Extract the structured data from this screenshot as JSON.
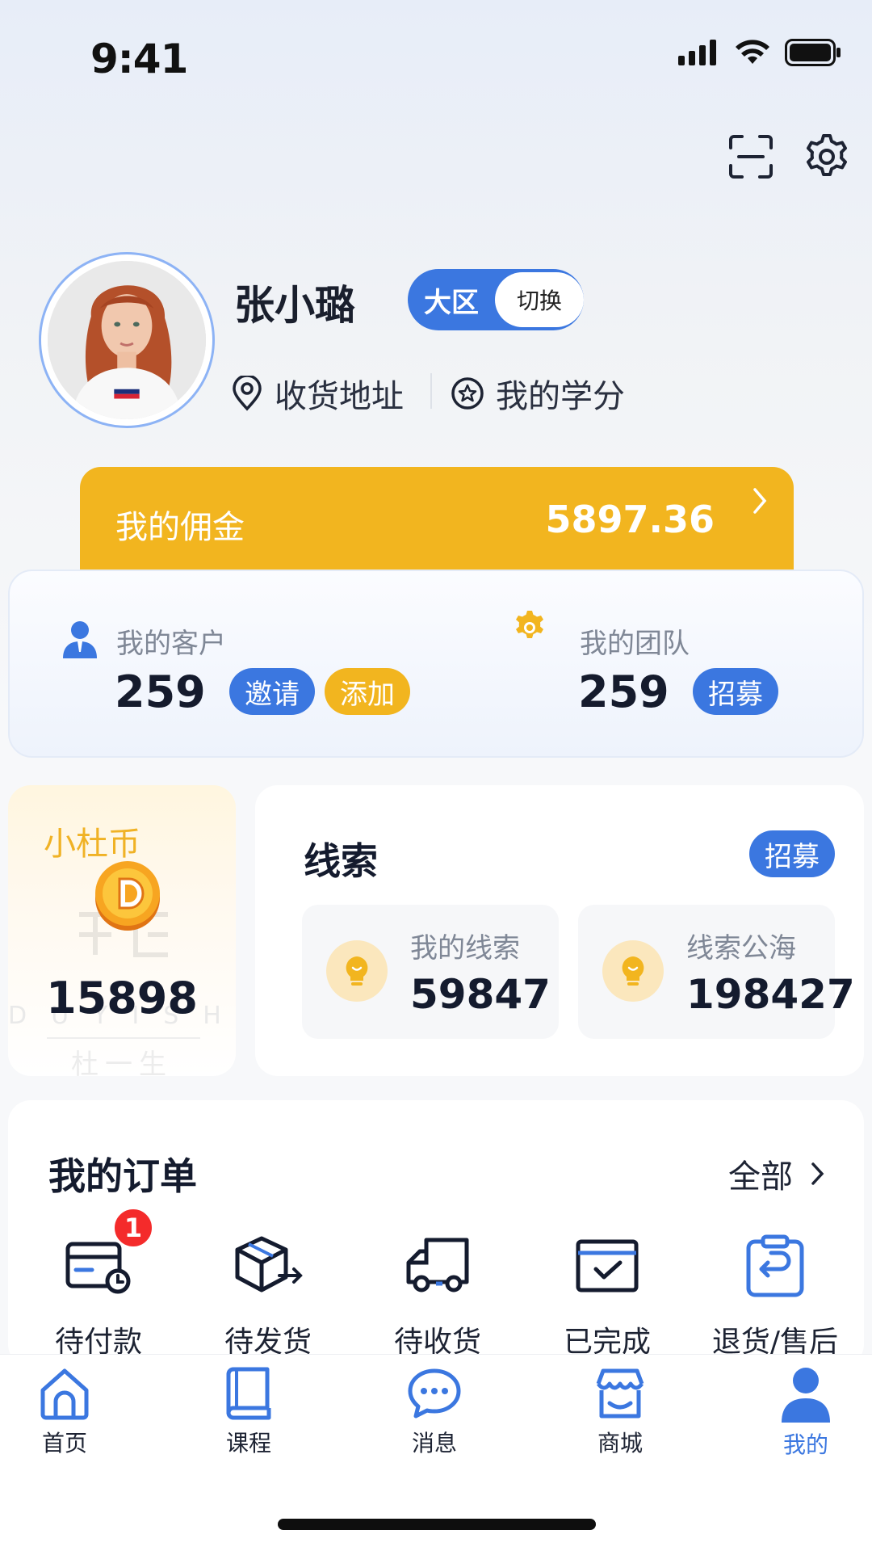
{
  "status_bar": {
    "time": "9:41"
  },
  "profile": {
    "name": "张小璐",
    "region_label": "大区",
    "switch_label": "切换",
    "address_label": "收货地址",
    "credits_label": "我的学分"
  },
  "commission": {
    "label": "我的佣金",
    "value": "5897.36"
  },
  "customers": {
    "label": "我的客户",
    "value": "259",
    "invite_label": "邀请",
    "add_label": "添加"
  },
  "team": {
    "label": "我的团队",
    "value": "259",
    "recruit_label": "招募"
  },
  "coin": {
    "title": "小杜币",
    "value": "15898",
    "logo_text": "DUYISHENG",
    "logo_cn": "杜一生"
  },
  "leads": {
    "title": "线索",
    "recruit_label": "招募",
    "items": [
      {
        "label": "我的线索",
        "value": "59847"
      },
      {
        "label": "线索公海",
        "value": "198427"
      }
    ]
  },
  "orders": {
    "title": "我的订单",
    "all_label": "全部",
    "items": [
      {
        "label": "待付款",
        "badge": "1",
        "icon": "wallet-clock-icon"
      },
      {
        "label": "待发货",
        "icon": "box-send-icon"
      },
      {
        "label": "待收货",
        "icon": "truck-icon"
      },
      {
        "label": "已完成",
        "icon": "check-calendar-icon"
      },
      {
        "label": "退货/售后",
        "icon": "return-icon"
      }
    ]
  },
  "tabbar": {
    "items": [
      {
        "label": "首页",
        "icon": "home-icon"
      },
      {
        "label": "课程",
        "icon": "book-icon"
      },
      {
        "label": "消息",
        "icon": "chat-icon"
      },
      {
        "label": "商城",
        "icon": "store-icon"
      },
      {
        "label": "我的",
        "icon": "user-icon",
        "active": true
      }
    ]
  },
  "colors": {
    "accent_blue": "#3b77e0",
    "accent_yellow": "#f2b51f",
    "badge_red": "#f42b2b"
  }
}
